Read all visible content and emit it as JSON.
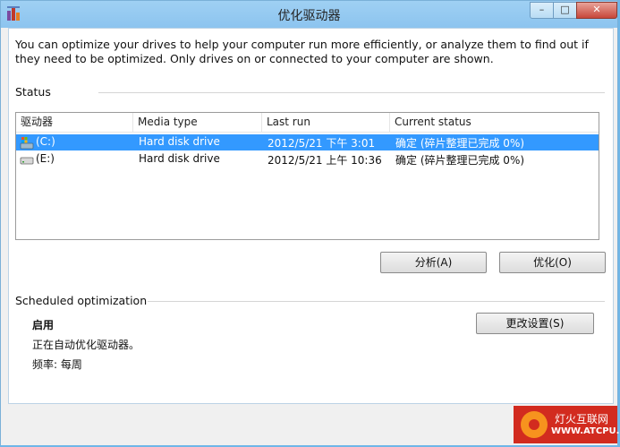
{
  "window": {
    "title": "优化驱动器",
    "controls": {
      "minimize": "–",
      "maximize": "□",
      "close": "✕"
    }
  },
  "description": "You can optimize your drives to help your computer run more efficiently, or analyze them to find out if they need to be optimized. Only drives on or connected to your computer are shown.",
  "status": {
    "section_label": "Status",
    "columns": [
      "驱动器",
      "Media type",
      "Last run",
      "Current status"
    ],
    "drives": [
      {
        "name": "(C:)",
        "media_type": "Hard disk drive",
        "last_run": "2012/5/21 下午 3:01",
        "status": "确定 (碎片整理已完成 0%)",
        "selected": true,
        "icon": "system-drive-icon"
      },
      {
        "name": "(E:)",
        "media_type": "Hard disk drive",
        "last_run": "2012/5/21 上午 10:36",
        "status": "确定 (碎片整理已完成 0%)",
        "selected": false,
        "icon": "hard-drive-icon"
      }
    ],
    "analyze_button": "分析(A)",
    "optimize_button": "优化(O)"
  },
  "scheduled": {
    "section_label": "Scheduled optimization",
    "state": "启用",
    "message": "正在自动优化驱动器。",
    "frequency": "频率: 每周",
    "change_button": "更改设置(S)"
  },
  "watermark": {
    "title": "灯火互联网",
    "url": "WWW.ATCPU.COM"
  },
  "colors": {
    "selection": "#3399ff",
    "titlebar": "#9fd0f3",
    "close_button": "#c7473a"
  }
}
